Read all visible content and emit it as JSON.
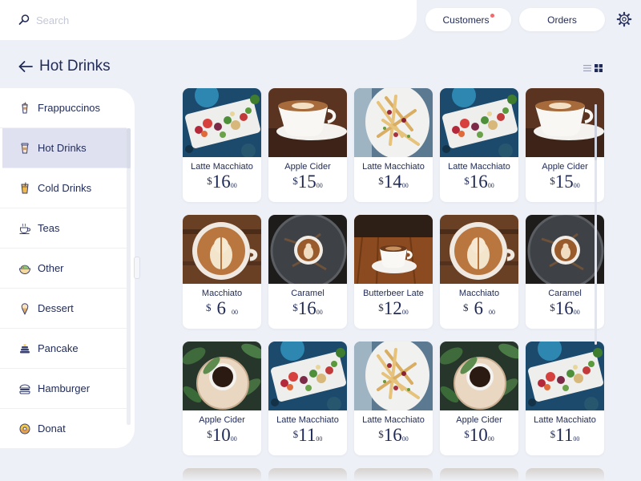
{
  "search": {
    "placeholder": "Search"
  },
  "header": {
    "customers_label": "Customers",
    "orders_label": "Orders",
    "has_customer_notification": true,
    "notification_color": "#f26a6a"
  },
  "page": {
    "title": "Hot Drinks"
  },
  "view_toggle": {
    "options": [
      "list-view-icon",
      "grid-view-icon"
    ],
    "active": "grid-view-icon"
  },
  "categories": [
    {
      "label": "Frappuccinos",
      "icon": "frappuccino-cup-icon"
    },
    {
      "label": "Hot Drinks",
      "icon": "hot-drink-cup-icon",
      "active": true
    },
    {
      "label": "Cold Drinks",
      "icon": "cold-drink-cup-icon"
    },
    {
      "label": "Teas",
      "icon": "teacup-icon"
    },
    {
      "label": "Other",
      "icon": "bowl-icon"
    },
    {
      "label": "Dessert",
      "icon": "ice-cream-icon"
    },
    {
      "label": "Pancake",
      "icon": "pancake-icon"
    },
    {
      "label": "Hamburger",
      "icon": "hamburger-icon"
    },
    {
      "label": "Donat",
      "icon": "donut-icon"
    }
  ],
  "products": [
    {
      "name": "Latte Macchiato",
      "currency": "$",
      "amount": "16",
      "cents": "00",
      "image": "salad-plate"
    },
    {
      "name": "Apple Cider",
      "currency": "$",
      "amount": "15",
      "cents": "00",
      "image": "latte-cup"
    },
    {
      "name": "Latte Macchiato",
      "currency": "$",
      "amount": "14",
      "cents": "00",
      "image": "fries-plate"
    },
    {
      "name": "Latte Macchiato",
      "currency": "$",
      "amount": "16",
      "cents": "00",
      "image": "salad-plate"
    },
    {
      "name": "Apple Cider",
      "currency": "$",
      "amount": "15",
      "cents": "00",
      "image": "latte-cup"
    },
    {
      "name": "Macchiato",
      "currency": "$",
      "amount": "6",
      "cents": "00",
      "image": "latte-art"
    },
    {
      "name": "Caramel",
      "currency": "$",
      "amount": "16",
      "cents": "00",
      "image": "coffee-on-stone"
    },
    {
      "name": "Butterbeer Late",
      "currency": "$",
      "amount": "12",
      "cents": "00",
      "image": "espresso-on-table"
    },
    {
      "name": "Macchiato",
      "currency": "$",
      "amount": "6",
      "cents": "00",
      "image": "latte-art"
    },
    {
      "name": "Caramel",
      "currency": "$",
      "amount": "16",
      "cents": "00",
      "image": "coffee-on-stone"
    },
    {
      "name": "Apple Cider",
      "currency": "$",
      "amount": "10",
      "cents": "00",
      "image": "coffee-with-leaves"
    },
    {
      "name": "Latte Macchiato",
      "currency": "$",
      "amount": "11",
      "cents": "00",
      "image": "salad-plate"
    },
    {
      "name": "Latte Macchiato",
      "currency": "$",
      "amount": "16",
      "cents": "00",
      "image": "fries-plate"
    },
    {
      "name": "Apple Cider",
      "currency": "$",
      "amount": "10",
      "cents": "00",
      "image": "coffee-with-leaves"
    },
    {
      "name": "Latte Macchiato",
      "currency": "$",
      "amount": "11",
      "cents": "00",
      "image": "salad-plate"
    }
  ],
  "colors": {
    "background": "#eef0f7",
    "panel": "#ffffff",
    "text": "#1f2a56",
    "active_category": "#dfe1f0"
  }
}
